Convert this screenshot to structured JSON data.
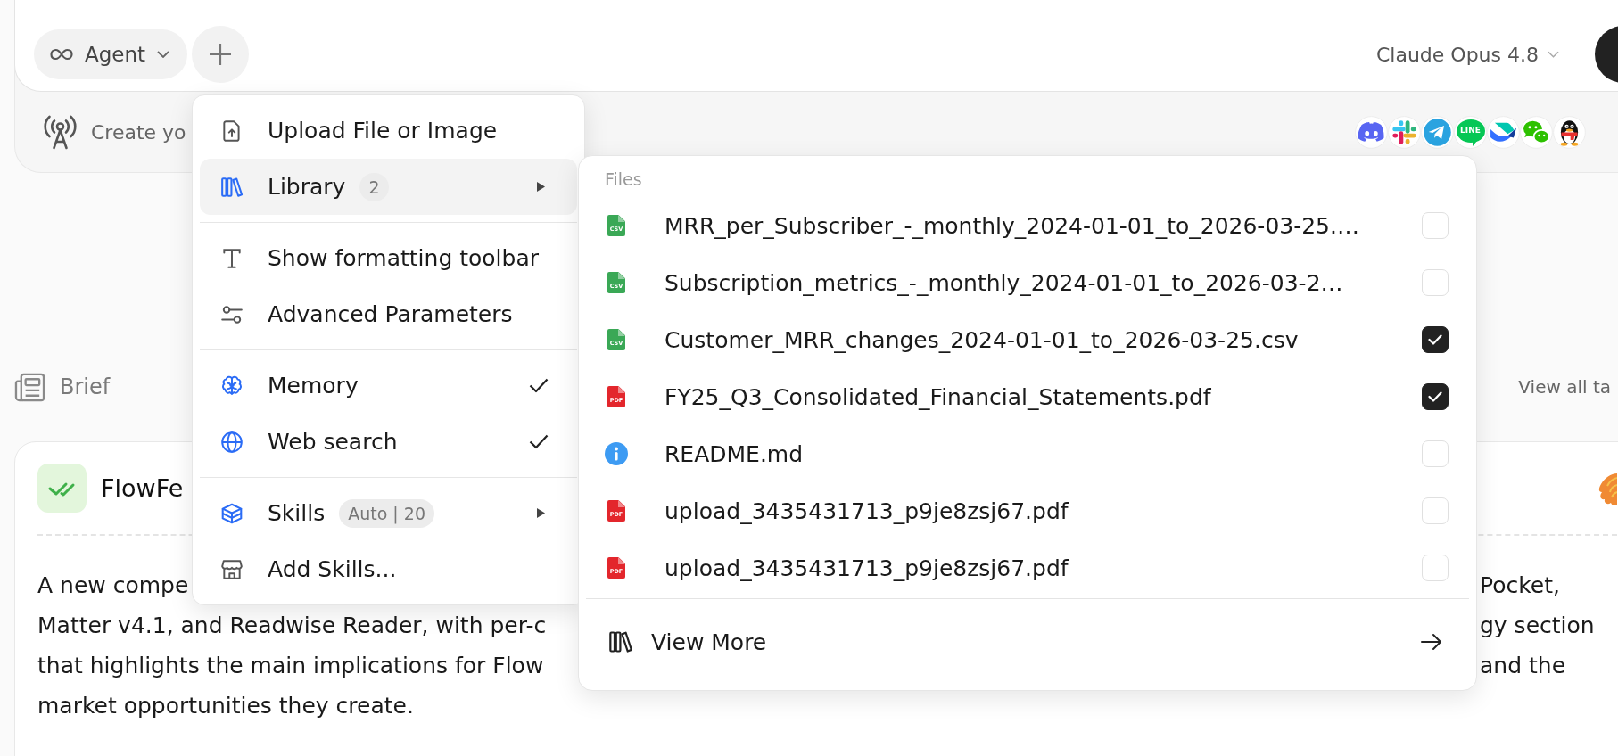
{
  "composer": {
    "mode": "Agent",
    "model": "Claude Opus 4.8"
  },
  "channel_bar": {
    "prompt": "Create yo",
    "logo_text": "LINE"
  },
  "brief": {
    "title": "Brief",
    "link": "View all ta"
  },
  "card": {
    "title": "FlowFe",
    "lines": [
      {
        "left": "A new compe",
        "right": "Pocket,"
      },
      {
        "left": "Matter v4.1, and Readwise Reader, with per-c",
        "right": "gy section"
      },
      {
        "left": "that highlights the main implications for Flow",
        "right": "and the"
      },
      {
        "left": "market opportunities they create."
      }
    ]
  },
  "menu": {
    "groups": [
      {
        "items": [
          {
            "kind": "action",
            "label": "Upload File or Image"
          },
          {
            "kind": "submenu",
            "label": "Library",
            "badge": "2",
            "expanded": true
          }
        ]
      },
      {
        "items": [
          {
            "kind": "action",
            "label": "Show formatting toolbar"
          },
          {
            "kind": "action",
            "label": "Advanced Parameters"
          }
        ]
      },
      {
        "items": [
          {
            "kind": "toggle",
            "label": "Memory",
            "checked": true
          },
          {
            "kind": "toggle",
            "label": "Web search",
            "checked": true
          }
        ]
      },
      {
        "items": [
          {
            "kind": "submenu",
            "label": "Skills",
            "badge": "Auto | 20",
            "expanded": false
          },
          {
            "kind": "action",
            "label": "Add Skills..."
          }
        ]
      }
    ]
  },
  "library": {
    "heading": "Files",
    "files": [
      {
        "name": "MRR_per_Subscriber_-_monthly_2024-01-01_to_2026-03-25.…",
        "kind": "file",
        "label": "CSV",
        "color": "#3aa856",
        "checked": false
      },
      {
        "name": "Subscription_metrics_-_monthly_2024-01-01_to_2026-03-2…",
        "kind": "file",
        "label": "CSV",
        "color": "#3aa856",
        "checked": false
      },
      {
        "name": "Customer_MRR_changes_2024-01-01_to_2026-03-25.csv",
        "kind": "file",
        "label": "CSV",
        "color": "#3aa856",
        "checked": true
      },
      {
        "name": "FY25_Q3_Consolidated_Financial_Statements.pdf",
        "kind": "file",
        "label": "PDF",
        "color": "#e3262c",
        "checked": true
      },
      {
        "name": "README.md",
        "kind": "info",
        "checked": false
      },
      {
        "name": "upload_3435431713_p9je8zsj67.pdf",
        "kind": "file",
        "label": "PDF",
        "color": "#e3262c",
        "checked": false
      },
      {
        "name": "upload_3435431713_p9je8zsj67.pdf",
        "kind": "file",
        "label": "PDF",
        "color": "#e3262c",
        "checked": false
      }
    ],
    "footer": "View More"
  }
}
